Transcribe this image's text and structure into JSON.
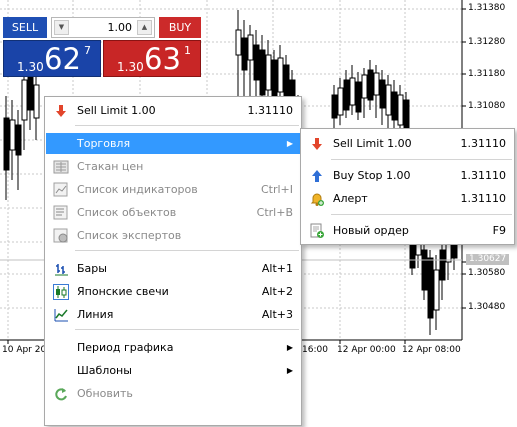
{
  "chart": {
    "price_labels": [
      "1.31380",
      "1.31280",
      "1.31180",
      "1.31080",
      "1.30580",
      "1.30480"
    ],
    "current_price": "1.30627",
    "time_labels": [
      "10 Apr 20",
      "16:00",
      "12 Apr 00:00",
      "12 Apr 08:00"
    ]
  },
  "trade_panel": {
    "sell_label": "SELL",
    "buy_label": "BUY",
    "volume": "1.00",
    "sell_small": "1.30",
    "sell_big": "62",
    "sell_sup": "7",
    "buy_small": "1.30",
    "buy_big": "63",
    "buy_sup": "1",
    "colors": {
      "sell": "#1a44a8",
      "buy": "#c82626"
    }
  },
  "context_menu": {
    "sell_limit": {
      "label": "Sell Limit 1.00",
      "price": "1.31110",
      "icon": "red-down-arrow-icon"
    },
    "trading": {
      "label": "Торговля"
    },
    "depth": {
      "label": "Стакан цен"
    },
    "indicators": {
      "label": "Список индикаторов",
      "shortcut": "Ctrl+I"
    },
    "objects": {
      "label": "Список объектов",
      "shortcut": "Ctrl+B"
    },
    "experts": {
      "label": "Список экспертов"
    },
    "bars": {
      "label": "Бары",
      "shortcut": "Alt+1"
    },
    "candles": {
      "label": "Японские свечи",
      "shortcut": "Alt+2"
    },
    "line": {
      "label": "Линия",
      "shortcut": "Alt+3"
    },
    "period": {
      "label": "Период графика"
    },
    "templates": {
      "label": "Шаблоны"
    },
    "refresh": {
      "label": "Обновить"
    },
    "highlight_color": "#3399ff"
  },
  "submenu": {
    "sell_limit": {
      "label": "Sell Limit 1.00",
      "price": "1.31110"
    },
    "buy_stop": {
      "label": "Buy Stop 1.00",
      "price": "1.31110"
    },
    "alert": {
      "label": "Алерт",
      "price": "1.31110"
    },
    "new_order": {
      "label": "Новый ордер",
      "shortcut": "F9"
    }
  }
}
